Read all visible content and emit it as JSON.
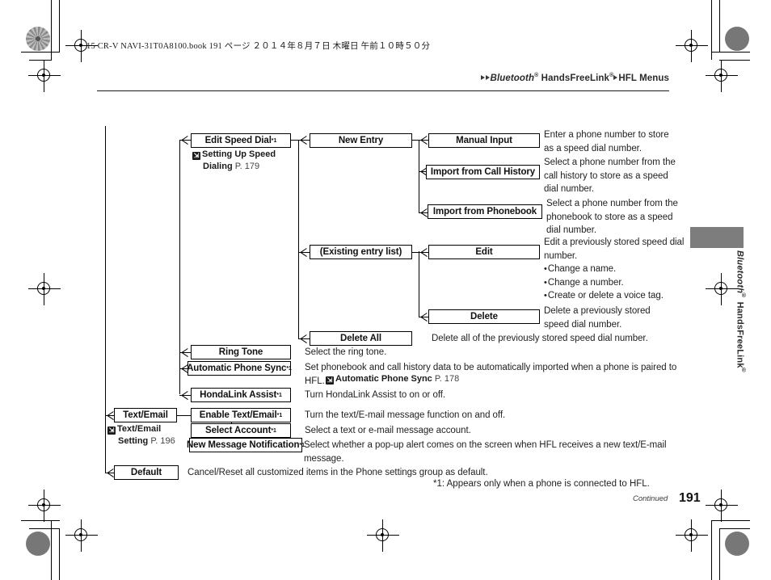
{
  "header": {
    "book_line": "15 CR-V NAVI-31T0A8100.book   191 ページ   ２０１４年８月７日   木曜日   午前１０時５０分",
    "breadcrumb_bluetooth": "Bluetooth",
    "breadcrumb_hfl": "HandsFreeLink",
    "breadcrumb_menus": "HFL Menus",
    "reg_mark": "®"
  },
  "side_tab": {
    "label_bluetooth": "Bluetooth",
    "label_hfl": "HandsFreeLink",
    "reg_mark": "®"
  },
  "flow": {
    "nodes": {
      "edit_speed_dial": "Edit Speed Dial",
      "new_entry": "New Entry",
      "manual_input": "Manual Input",
      "import_call_history": "Import from Call History",
      "import_phonebook": "Import from Phonebook",
      "existing_entry_list": "(Existing entry list)",
      "edit": "Edit",
      "delete": "Delete",
      "delete_all": "Delete All",
      "ring_tone": "Ring Tone",
      "automatic_phone_sync": "Automatic Phone Sync",
      "hondalink_assist": "HondaLink Assist",
      "text_email": "Text/Email",
      "enable_text_email": "Enable Text/Email",
      "select_account": "Select Account",
      "new_message_notification": "New Message Notification",
      "default": "Default"
    },
    "footnote_mark": "*1",
    "refs": {
      "speed_dial": {
        "icon": "jump-icon",
        "line1": "Setting Up Speed",
        "line2": "Dialing",
        "page": "P. 179"
      },
      "auto_sync": {
        "icon": "jump-icon",
        "title": "Automatic Phone Sync",
        "page": "P. 178"
      },
      "text_email": {
        "icon": "jump-icon",
        "line1": "Text/Email",
        "line2": "Setting",
        "page": "P. 196"
      }
    },
    "descriptions": {
      "manual_input": "Enter a phone number to store as a speed dial number.",
      "import_call_history": "Select a phone number from the call history to store as a speed dial number.",
      "import_phonebook": "Select a phone number from the phonebook to store as a speed dial number.",
      "edit_main": "Edit a previously stored speed dial number.",
      "edit_bullets": [
        "Change a name.",
        "Change a number.",
        "Create or delete a voice tag."
      ],
      "delete": "Delete a previously stored speed dial number.",
      "delete_all": "Delete all of the previously stored speed dial number.",
      "ring_tone": "Select the ring tone.",
      "automatic_phone_sync": "Set phonebook and call history data to be automatically imported when a phone is paired to HFL.",
      "hondalink_assist": "Turn HondaLink Assist to on or off.",
      "enable_text_email": "Turn the text/E-mail message function on and off.",
      "select_account": "Select a text or e-mail message account.",
      "new_message_notification": "Select whether a pop-up alert comes on the screen when HFL receives a new text/E-mail message.",
      "default": "Cancel/Reset all customized items in the Phone settings group as default."
    }
  },
  "footer": {
    "footnote": "*1: Appears only when a phone is connected to HFL.",
    "continued": "Continued",
    "page_number": "191"
  }
}
